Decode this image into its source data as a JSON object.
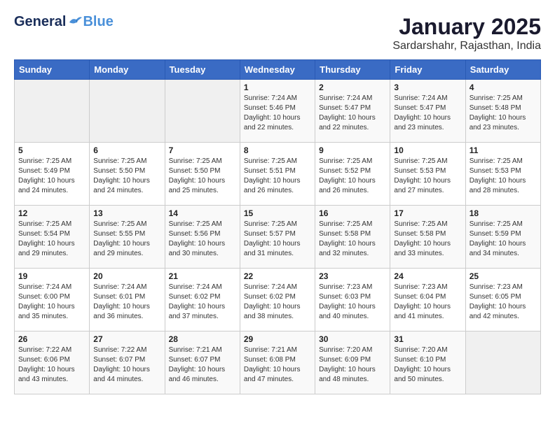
{
  "header": {
    "logo_general": "General",
    "logo_blue": "Blue",
    "title": "January 2025",
    "subtitle": "Sardarshahr, Rajasthan, India"
  },
  "calendar": {
    "days_of_week": [
      "Sunday",
      "Monday",
      "Tuesday",
      "Wednesday",
      "Thursday",
      "Friday",
      "Saturday"
    ],
    "weeks": [
      [
        {
          "day": "",
          "content": ""
        },
        {
          "day": "",
          "content": ""
        },
        {
          "day": "",
          "content": ""
        },
        {
          "day": "1",
          "content": "Sunrise: 7:24 AM\nSunset: 5:46 PM\nDaylight: 10 hours\nand 22 minutes."
        },
        {
          "day": "2",
          "content": "Sunrise: 7:24 AM\nSunset: 5:47 PM\nDaylight: 10 hours\nand 22 minutes."
        },
        {
          "day": "3",
          "content": "Sunrise: 7:24 AM\nSunset: 5:47 PM\nDaylight: 10 hours\nand 23 minutes."
        },
        {
          "day": "4",
          "content": "Sunrise: 7:25 AM\nSunset: 5:48 PM\nDaylight: 10 hours\nand 23 minutes."
        }
      ],
      [
        {
          "day": "5",
          "content": "Sunrise: 7:25 AM\nSunset: 5:49 PM\nDaylight: 10 hours\nand 24 minutes."
        },
        {
          "day": "6",
          "content": "Sunrise: 7:25 AM\nSunset: 5:50 PM\nDaylight: 10 hours\nand 24 minutes."
        },
        {
          "day": "7",
          "content": "Sunrise: 7:25 AM\nSunset: 5:50 PM\nDaylight: 10 hours\nand 25 minutes."
        },
        {
          "day": "8",
          "content": "Sunrise: 7:25 AM\nSunset: 5:51 PM\nDaylight: 10 hours\nand 26 minutes."
        },
        {
          "day": "9",
          "content": "Sunrise: 7:25 AM\nSunset: 5:52 PM\nDaylight: 10 hours\nand 26 minutes."
        },
        {
          "day": "10",
          "content": "Sunrise: 7:25 AM\nSunset: 5:53 PM\nDaylight: 10 hours\nand 27 minutes."
        },
        {
          "day": "11",
          "content": "Sunrise: 7:25 AM\nSunset: 5:53 PM\nDaylight: 10 hours\nand 28 minutes."
        }
      ],
      [
        {
          "day": "12",
          "content": "Sunrise: 7:25 AM\nSunset: 5:54 PM\nDaylight: 10 hours\nand 29 minutes."
        },
        {
          "day": "13",
          "content": "Sunrise: 7:25 AM\nSunset: 5:55 PM\nDaylight: 10 hours\nand 29 minutes."
        },
        {
          "day": "14",
          "content": "Sunrise: 7:25 AM\nSunset: 5:56 PM\nDaylight: 10 hours\nand 30 minutes."
        },
        {
          "day": "15",
          "content": "Sunrise: 7:25 AM\nSunset: 5:57 PM\nDaylight: 10 hours\nand 31 minutes."
        },
        {
          "day": "16",
          "content": "Sunrise: 7:25 AM\nSunset: 5:58 PM\nDaylight: 10 hours\nand 32 minutes."
        },
        {
          "day": "17",
          "content": "Sunrise: 7:25 AM\nSunset: 5:58 PM\nDaylight: 10 hours\nand 33 minutes."
        },
        {
          "day": "18",
          "content": "Sunrise: 7:25 AM\nSunset: 5:59 PM\nDaylight: 10 hours\nand 34 minutes."
        }
      ],
      [
        {
          "day": "19",
          "content": "Sunrise: 7:24 AM\nSunset: 6:00 PM\nDaylight: 10 hours\nand 35 minutes."
        },
        {
          "day": "20",
          "content": "Sunrise: 7:24 AM\nSunset: 6:01 PM\nDaylight: 10 hours\nand 36 minutes."
        },
        {
          "day": "21",
          "content": "Sunrise: 7:24 AM\nSunset: 6:02 PM\nDaylight: 10 hours\nand 37 minutes."
        },
        {
          "day": "22",
          "content": "Sunrise: 7:24 AM\nSunset: 6:02 PM\nDaylight: 10 hours\nand 38 minutes."
        },
        {
          "day": "23",
          "content": "Sunrise: 7:23 AM\nSunset: 6:03 PM\nDaylight: 10 hours\nand 40 minutes."
        },
        {
          "day": "24",
          "content": "Sunrise: 7:23 AM\nSunset: 6:04 PM\nDaylight: 10 hours\nand 41 minutes."
        },
        {
          "day": "25",
          "content": "Sunrise: 7:23 AM\nSunset: 6:05 PM\nDaylight: 10 hours\nand 42 minutes."
        }
      ],
      [
        {
          "day": "26",
          "content": "Sunrise: 7:22 AM\nSunset: 6:06 PM\nDaylight: 10 hours\nand 43 minutes."
        },
        {
          "day": "27",
          "content": "Sunrise: 7:22 AM\nSunset: 6:07 PM\nDaylight: 10 hours\nand 44 minutes."
        },
        {
          "day": "28",
          "content": "Sunrise: 7:21 AM\nSunset: 6:07 PM\nDaylight: 10 hours\nand 46 minutes."
        },
        {
          "day": "29",
          "content": "Sunrise: 7:21 AM\nSunset: 6:08 PM\nDaylight: 10 hours\nand 47 minutes."
        },
        {
          "day": "30",
          "content": "Sunrise: 7:20 AM\nSunset: 6:09 PM\nDaylight: 10 hours\nand 48 minutes."
        },
        {
          "day": "31",
          "content": "Sunrise: 7:20 AM\nSunset: 6:10 PM\nDaylight: 10 hours\nand 50 minutes."
        },
        {
          "day": "",
          "content": ""
        }
      ]
    ]
  }
}
